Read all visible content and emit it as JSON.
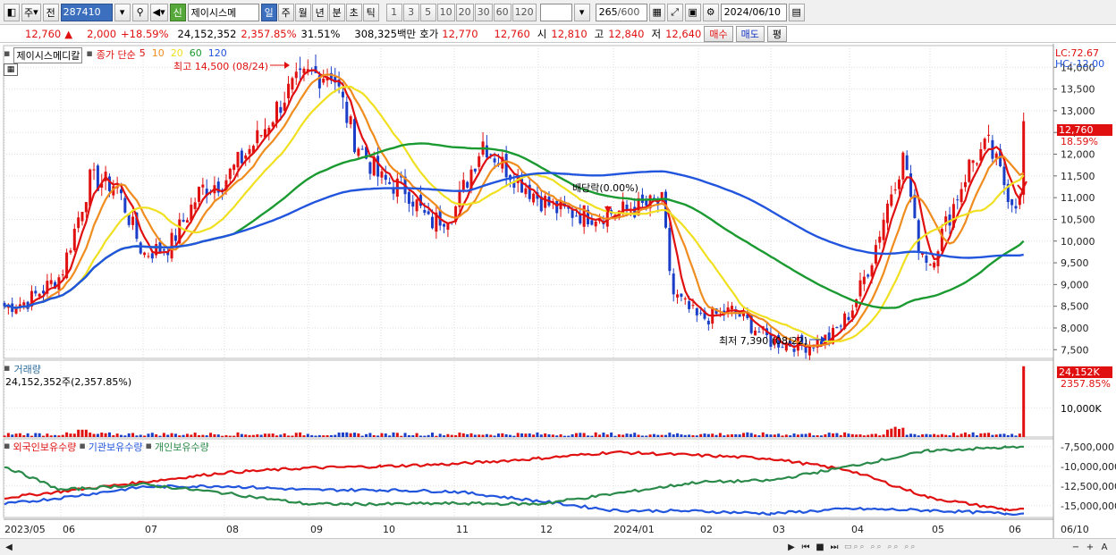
{
  "toolbar": {
    "period_dropdown": "주",
    "prev_label": "전",
    "stock_code": "287410",
    "new_badge": "신",
    "stock_name_short": "제이시스메",
    "tabs": [
      "일",
      "주",
      "월",
      "년",
      "분",
      "초",
      "틱"
    ],
    "active_tab_index": 0,
    "intervals": [
      "1",
      "3",
      "5",
      "10",
      "20",
      "30",
      "60",
      "120"
    ],
    "count_current": "265",
    "count_total": "/600",
    "date": "2024/06/10"
  },
  "info": {
    "price": "12,760",
    "change_arrow": "▲",
    "change": "2,000",
    "change_pct": "+18.59%",
    "volume": "24,152,352",
    "volume_pct": "2,357.85%",
    "turnover": "31.51%",
    "amount": "308,325백만",
    "bid_label": "호가",
    "bid1": "12,770",
    "bid2": "12,760",
    "open_label": "시",
    "open": "12,810",
    "high_label": "고",
    "high": "12,840",
    "low_label": "저",
    "low": "12,640",
    "buy_btn": "매수",
    "sell_btn": "매도",
    "eval_btn": "평"
  },
  "price_panel": {
    "stock_name": "제이시스메디칼",
    "ma_label": "종가 단순",
    "ma_periods": [
      "5",
      "10",
      "20",
      "60",
      "120"
    ],
    "ma_colors": [
      "#e01010",
      "#f08c1e",
      "#f0e020",
      "#1a9a30",
      "#2255dd"
    ],
    "high_note": "최고 14,500 (08/24)",
    "low_note": "최저 7,390 (08/22)",
    "dividend_note": "배당락(0.00%)",
    "lc": "LC:72.67",
    "hc": "HC:-12.00",
    "last_price": "12,760",
    "last_pct": "18.59%",
    "y_ticks": [
      "14,000",
      "13,500",
      "13,000",
      "12,500",
      "12,000",
      "11,500",
      "11,000",
      "10,500",
      "10,000",
      "9,500",
      "9,000",
      "8,500",
      "8,000",
      "7,500"
    ]
  },
  "volume_panel": {
    "title": "거래량",
    "value_text": "24,152,352주(2,357.85%)",
    "last_label": "24,152K",
    "last_pct": "2357.85%",
    "y_tick": "10,000K"
  },
  "holding_panel": {
    "titles": [
      "외국인보유수량",
      "기관보유수량",
      "개인보유수량"
    ],
    "colors": [
      "#e01010",
      "#2255dd",
      "#2a8a4a"
    ],
    "y_ticks": [
      "-7,500,000",
      "-10,000,000",
      "-12,500,000",
      "-15,000,000"
    ]
  },
  "x_axis": [
    "2023/05",
    "06",
    "07",
    "08",
    "09",
    "10",
    "11",
    "12",
    "2024/01",
    "02",
    "03",
    "04",
    "05",
    "06",
    "06/10"
  ],
  "chart_data": [
    {
      "type": "candlestick",
      "title": "제이시스메디칼",
      "x": [
        "2023/05",
        "06",
        "07",
        "08",
        "09",
        "10",
        "11",
        "12",
        "2024/01",
        "02",
        "03",
        "04",
        "05",
        "06"
      ],
      "close_monthly_approx": [
        8600,
        11400,
        9700,
        12000,
        13800,
        10400,
        11800,
        10600,
        10900,
        8300,
        7700,
        11000,
        10000,
        12760
      ],
      "ylim": [
        7300,
        14500
      ],
      "series": [
        {
          "name": "5",
          "color": "#e01010"
        },
        {
          "name": "10",
          "color": "#f08c1e"
        },
        {
          "name": "20",
          "color": "#f0e020"
        },
        {
          "name": "60",
          "color": "#1a9a30"
        },
        {
          "name": "120",
          "color": "#2255dd"
        }
      ]
    },
    {
      "type": "bar",
      "title": "거래량",
      "ylim": [
        0,
        25000000
      ],
      "last_value": 24152352
    },
    {
      "type": "line",
      "title": "외국인보유수량 · 기관보유수량 · 개인보유수량",
      "ylim": [
        -16500000,
        -6500000
      ],
      "series": [
        {
          "name": "외국인보유수량",
          "values": [
            -14000000,
            -13200000,
            -12000000,
            -10800000,
            -10200000,
            -10000000,
            -9700000,
            -9000000,
            -8200000,
            -8600000,
            -9000000,
            -10500000,
            -14000000,
            -15500000
          ]
        },
        {
          "name": "기관보유수량",
          "values": [
            -14800000,
            -14000000,
            -12600000,
            -12500000,
            -13000000,
            -13000000,
            -13200000,
            -14400000,
            -15600000,
            -15700000,
            -16000000,
            -15400000,
            -15600000,
            -16000000
          ]
        },
        {
          "name": "개인보유수량",
          "values": [
            -10000000,
            -13000000,
            -12300000,
            -13400000,
            -14800000,
            -14800000,
            -14700000,
            -14800000,
            -13500000,
            -12000000,
            -11800000,
            -10000000,
            -8000000,
            -7600000
          ]
        }
      ]
    }
  ]
}
